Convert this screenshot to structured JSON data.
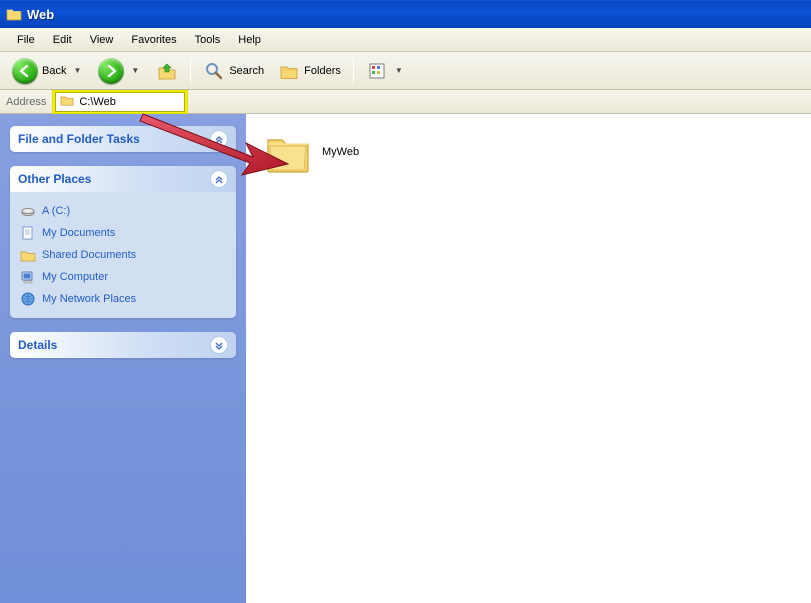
{
  "window": {
    "title": "Web"
  },
  "menubar": {
    "items": [
      "File",
      "Edit",
      "View",
      "Favorites",
      "Tools",
      "Help"
    ]
  },
  "toolbar": {
    "back_label": "Back",
    "search_label": "Search",
    "folders_label": "Folders"
  },
  "addressbar": {
    "label": "Address",
    "path": "C:\\Web"
  },
  "sidepanel": {
    "file_tasks": {
      "title": "File and Folder Tasks"
    },
    "other_places": {
      "title": "Other Places",
      "items": [
        {
          "label": "A (C:)",
          "icon": "drive-icon"
        },
        {
          "label": "My Documents",
          "icon": "documents-icon"
        },
        {
          "label": "Shared Documents",
          "icon": "shared-folder-icon"
        },
        {
          "label": "My Computer",
          "icon": "computer-icon"
        },
        {
          "label": "My Network Places",
          "icon": "network-icon"
        }
      ]
    },
    "details": {
      "title": "Details"
    }
  },
  "content": {
    "items": [
      {
        "name": "MyWeb",
        "type": "folder"
      }
    ]
  }
}
